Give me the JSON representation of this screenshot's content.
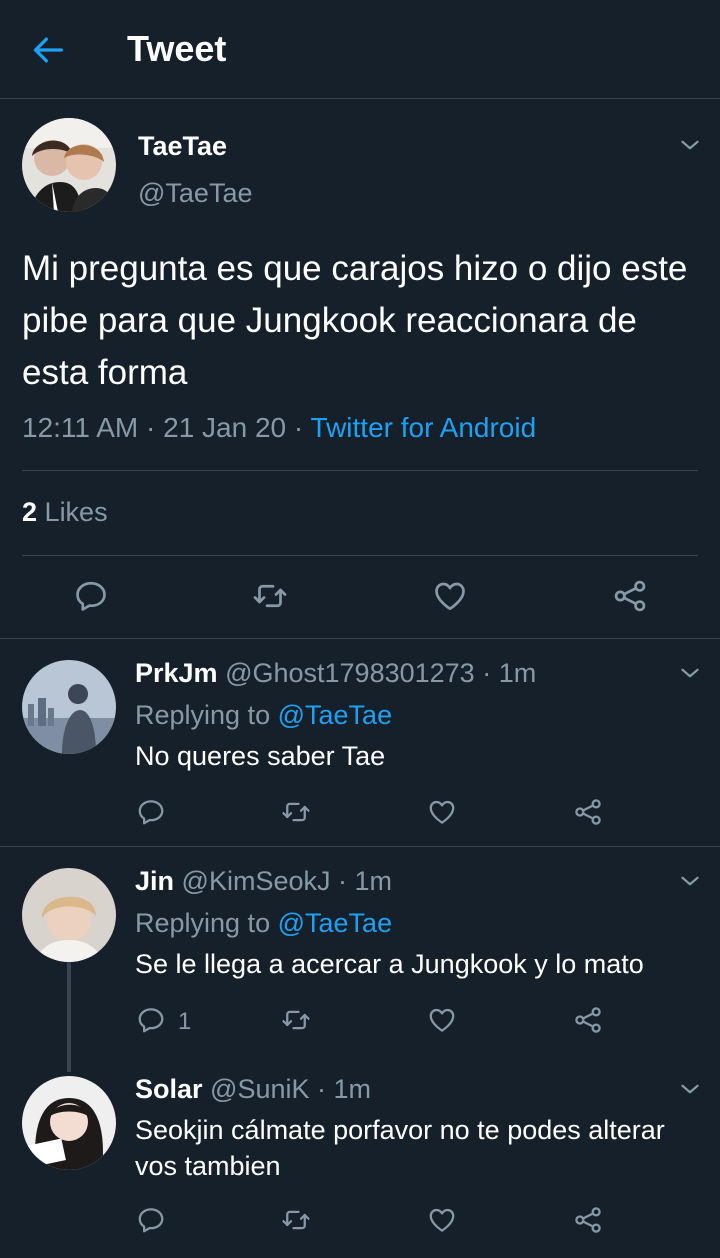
{
  "header": {
    "title": "Tweet"
  },
  "tweet": {
    "name": "TaeTae",
    "handle": "@TaeTae",
    "text": "Mi pregunta es que carajos hizo o dijo este pibe para que Jungkook reaccionara de esta forma",
    "time": "12:11 AM",
    "date": "21 Jan 20",
    "source": "Twitter for Android",
    "likes_count": "2",
    "likes_label": "Likes"
  },
  "replies": [
    {
      "name": "PrkJm",
      "handle": "@Ghost1798301273",
      "age": "1m",
      "replying_label": "Replying to",
      "replying_to": "@TaeTae",
      "text": "No queres saber Tae",
      "reply_count": ""
    },
    {
      "name": "Jin",
      "handle": "@KimSeokJ",
      "age": "1m",
      "replying_label": "Replying to",
      "replying_to": "@TaeTae",
      "text": "Se le llega a acercar a Jungkook y lo mato",
      "reply_count": "1"
    },
    {
      "name": "Solar",
      "handle": "@SuniK",
      "age": "1m",
      "text": "Seokjin cálmate porfavor no te podes alterar vos tambien",
      "reply_count": ""
    }
  ],
  "colors": {
    "background": "#15202b",
    "accent": "#1da1f2",
    "muted_text": "#8899a6",
    "divider": "#38444d"
  },
  "icons": {
    "back": "arrow-left-icon",
    "more": "chevron-down-icon",
    "reply": "speech-bubble-icon",
    "retweet": "retweet-icon",
    "like": "heart-icon",
    "share": "share-icon"
  }
}
